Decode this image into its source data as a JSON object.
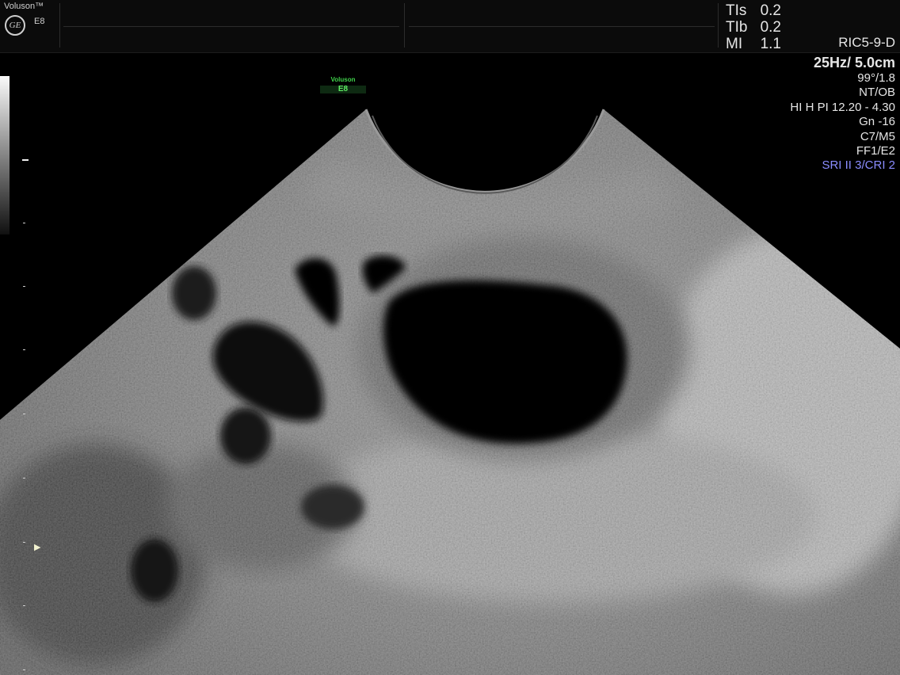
{
  "header": {
    "brand": "Voluson™",
    "logo_text": "GE",
    "model": "E8",
    "tis_label": "TIs",
    "tis_value": "0.2",
    "tib_label": "TIb",
    "tib_value": "0.2",
    "mi_label": "MI",
    "mi_value": "1.1",
    "probe": "RIC5-9-D"
  },
  "params": {
    "frequency_depth": "25Hz/ 5.0cm",
    "angle": "99°/1.8",
    "preset": "NT/OB",
    "harmonics": "HI H PI 12.20 - 4.30",
    "gain": "Gn -16",
    "compound": "C7/M5",
    "filter": "FF1/E2",
    "sri": "SRI II 3/CRI 2"
  },
  "watermark": {
    "brand": "Voluson",
    "model": "E8"
  },
  "colors": {
    "accent_blue": "#8a8cff",
    "watermark_green": "#3fd14a"
  },
  "icons": [
    "ge-logo-icon",
    "focus-marker-icon"
  ]
}
